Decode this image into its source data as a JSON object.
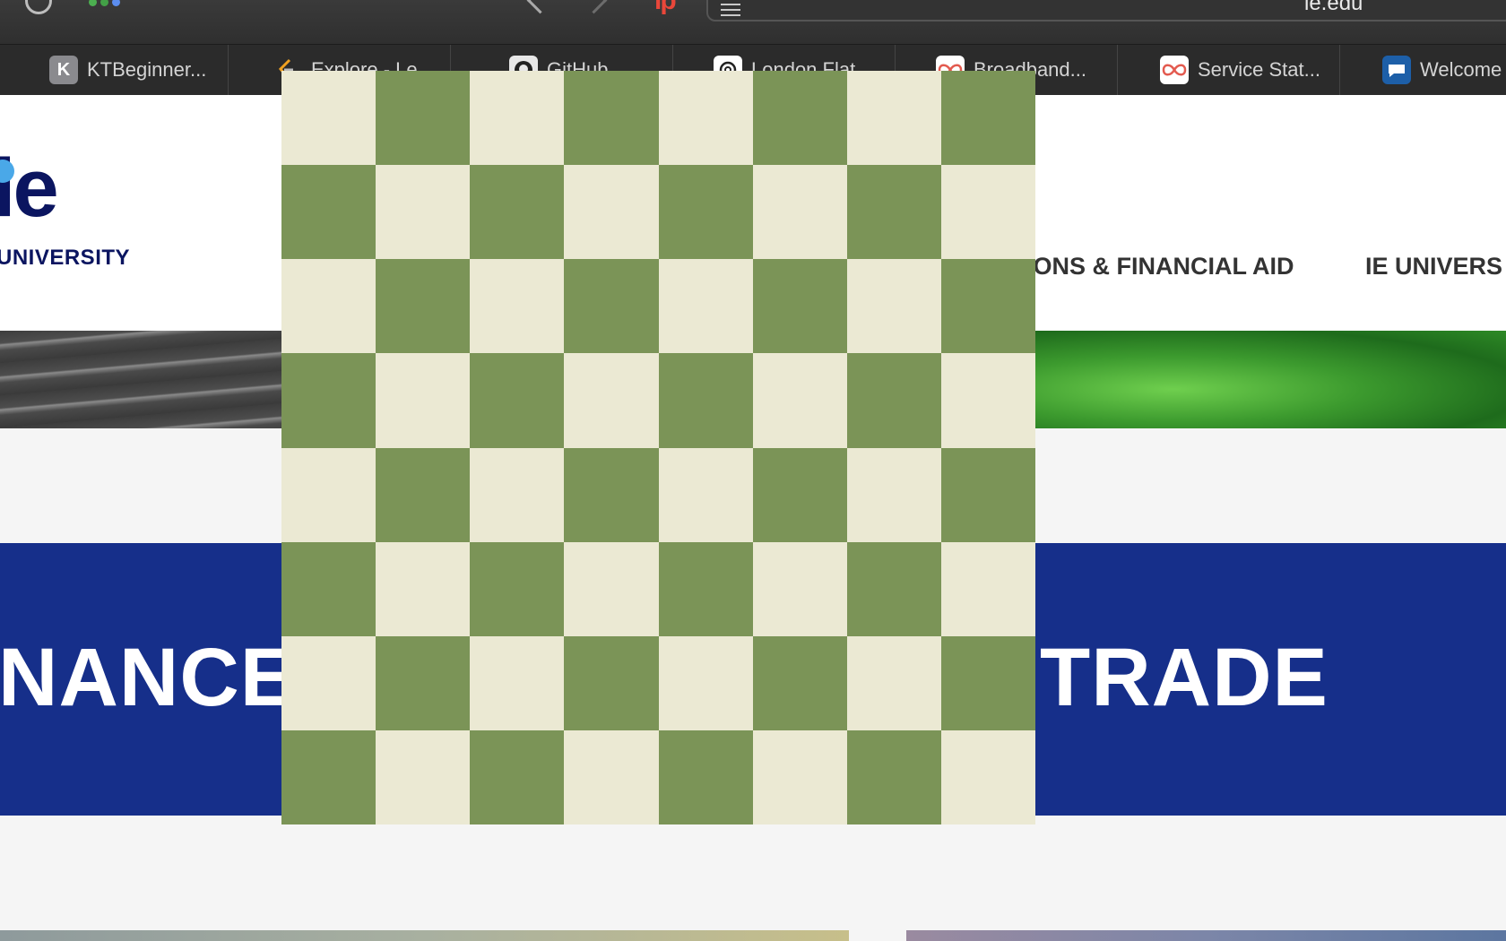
{
  "browser": {
    "address": "ie.edu",
    "tabs": [
      {
        "label": "KTBeginner...",
        "icon": "k-letter-icon",
        "icon_letter": "K",
        "icon_color": "#8a8a8e"
      },
      {
        "label": "Explore - Le...",
        "icon": "leetcode-icon",
        "icon_color": "#f0a020"
      },
      {
        "label": "GitHub",
        "icon": "github-icon",
        "icon_color": "#e8e8e8"
      },
      {
        "label": "London Flat...",
        "icon": "openai-icon",
        "icon_color": "#ffffff"
      },
      {
        "label": "Broadband...",
        "icon": "infinity-icon",
        "icon_color": "#e35a4f"
      },
      {
        "label": "Service Stat...",
        "icon": "infinity-icon",
        "icon_color": "#e35a4f"
      },
      {
        "label": "Welcome",
        "icon": "chat-icon",
        "icon_color": "#1d5fa8"
      }
    ]
  },
  "site": {
    "logo_text": "ie",
    "logo_subtext": "UNIVERSITY",
    "nav": [
      "IONS & FINANCIAL AID",
      "IE UNIVERS"
    ],
    "band_words": [
      "NANCE",
      "TRADE"
    ]
  },
  "chessboard": {
    "rows": 8,
    "cols": 8,
    "light_color": "#ebe9d3",
    "dark_color": "#7b9457"
  }
}
